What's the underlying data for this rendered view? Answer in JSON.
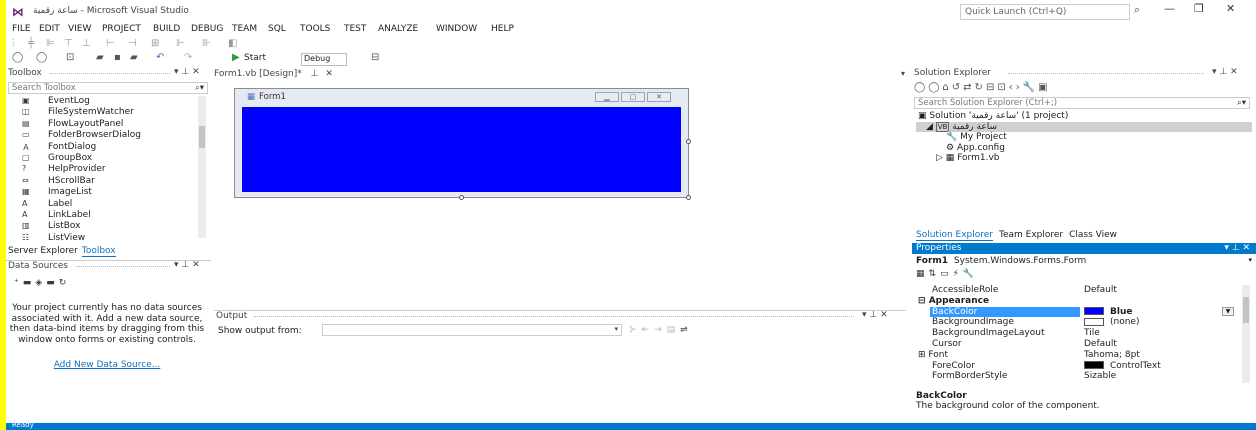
{
  "window": {
    "title": "ساعة رقمية - Microsoft Visual Studio",
    "quick_launch": "Quick Launch (Ctrl+Q)"
  },
  "menu": [
    "FILE",
    "EDIT",
    "VIEW",
    "PROJECT",
    "BUILD",
    "DEBUG",
    "TEAM",
    "SQL",
    "TOOLS",
    "TEST",
    "ANALYZE",
    "WINDOW",
    "HELP"
  ],
  "toolbar": {
    "start_label": "Start",
    "config": "Debug"
  },
  "toolbox": {
    "title": "Toolbox",
    "search_placeholder": "Search Toolbox",
    "items": [
      {
        "icon": "▣",
        "label": "EventLog"
      },
      {
        "icon": "◫",
        "label": "FileSystemWatcher"
      },
      {
        "icon": "▤",
        "label": "FlowLayoutPanel"
      },
      {
        "icon": "▭",
        "label": "FolderBrowserDialog"
      },
      {
        "icon": "Ａ",
        "label": "FontDialog"
      },
      {
        "icon": "▢",
        "label": "GroupBox"
      },
      {
        "icon": "?",
        "label": "HelpProvider"
      },
      {
        "icon": "⇔",
        "label": "HScrollBar"
      },
      {
        "icon": "▦",
        "label": "ImageList"
      },
      {
        "icon": "A",
        "label": "Label"
      },
      {
        "icon": "A",
        "label": "LinkLabel"
      },
      {
        "icon": "▥",
        "label": "ListBox"
      },
      {
        "icon": "☷",
        "label": "ListView"
      }
    ],
    "tabs": [
      "Server Explorer",
      "Toolbox"
    ]
  },
  "data_sources": {
    "title": "Data Sources",
    "message": "Your project currently has no data sources associated with it. Add a new data source, then data-bind items by dragging from this window onto forms or existing controls.",
    "link": "Add New Data Source..."
  },
  "document_tab": "Form1.vb [Design]*",
  "form": {
    "title": "Form1",
    "backcolor": "#0000ff"
  },
  "output": {
    "title": "Output",
    "show_from": "Show output from:"
  },
  "solution_explorer": {
    "title": "Solution Explorer",
    "search_placeholder": "Search Solution Explorer (Ctrl+;)",
    "tree": [
      {
        "indent": 0,
        "expander": "",
        "icon": "▣",
        "label": "Solution 'ساعة رقمية' (1 project)",
        "selected": false
      },
      {
        "indent": 1,
        "expander": "◢",
        "icon": "VB",
        "label": "ساعة رقمية",
        "selected": true
      },
      {
        "indent": 2,
        "expander": "",
        "icon": "🔧",
        "label": "My Project",
        "selected": false
      },
      {
        "indent": 2,
        "expander": "",
        "icon": "⚙",
        "label": "App.config",
        "selected": false
      },
      {
        "indent": 2,
        "expander": "▷",
        "icon": "▦",
        "label": "Form1.vb",
        "selected": false
      }
    ],
    "tabs": [
      "Solution Explorer",
      "Team Explorer",
      "Class View"
    ]
  },
  "properties": {
    "title": "Properties",
    "object": "Form1",
    "object_type": "System.Windows.Forms.Form",
    "rows": [
      {
        "type": "prop",
        "name": "AccessibleRole",
        "value": "Default"
      },
      {
        "type": "category",
        "name": "Appearance",
        "value": ""
      },
      {
        "type": "prop",
        "name": "BackColor",
        "value": "Blue",
        "swatch": "#0000ff",
        "selected": true
      },
      {
        "type": "prop",
        "name": "BackgroundImage",
        "value": "(none)",
        "swatch": "#ffffff"
      },
      {
        "type": "prop",
        "name": "BackgroundImageLayout",
        "value": "Tile"
      },
      {
        "type": "prop",
        "name": "Cursor",
        "value": "Default"
      },
      {
        "type": "prop",
        "name": "Font",
        "value": "Tahoma; 8pt",
        "expandable": true
      },
      {
        "type": "prop",
        "name": "ForeColor",
        "value": "ControlText",
        "swatch": "#000000"
      },
      {
        "type": "prop",
        "name": "FormBorderStyle",
        "value": "Sizable"
      }
    ],
    "desc_title": "BackColor",
    "desc_text": "The background color of the component."
  },
  "status": {
    "text": "Ready"
  }
}
